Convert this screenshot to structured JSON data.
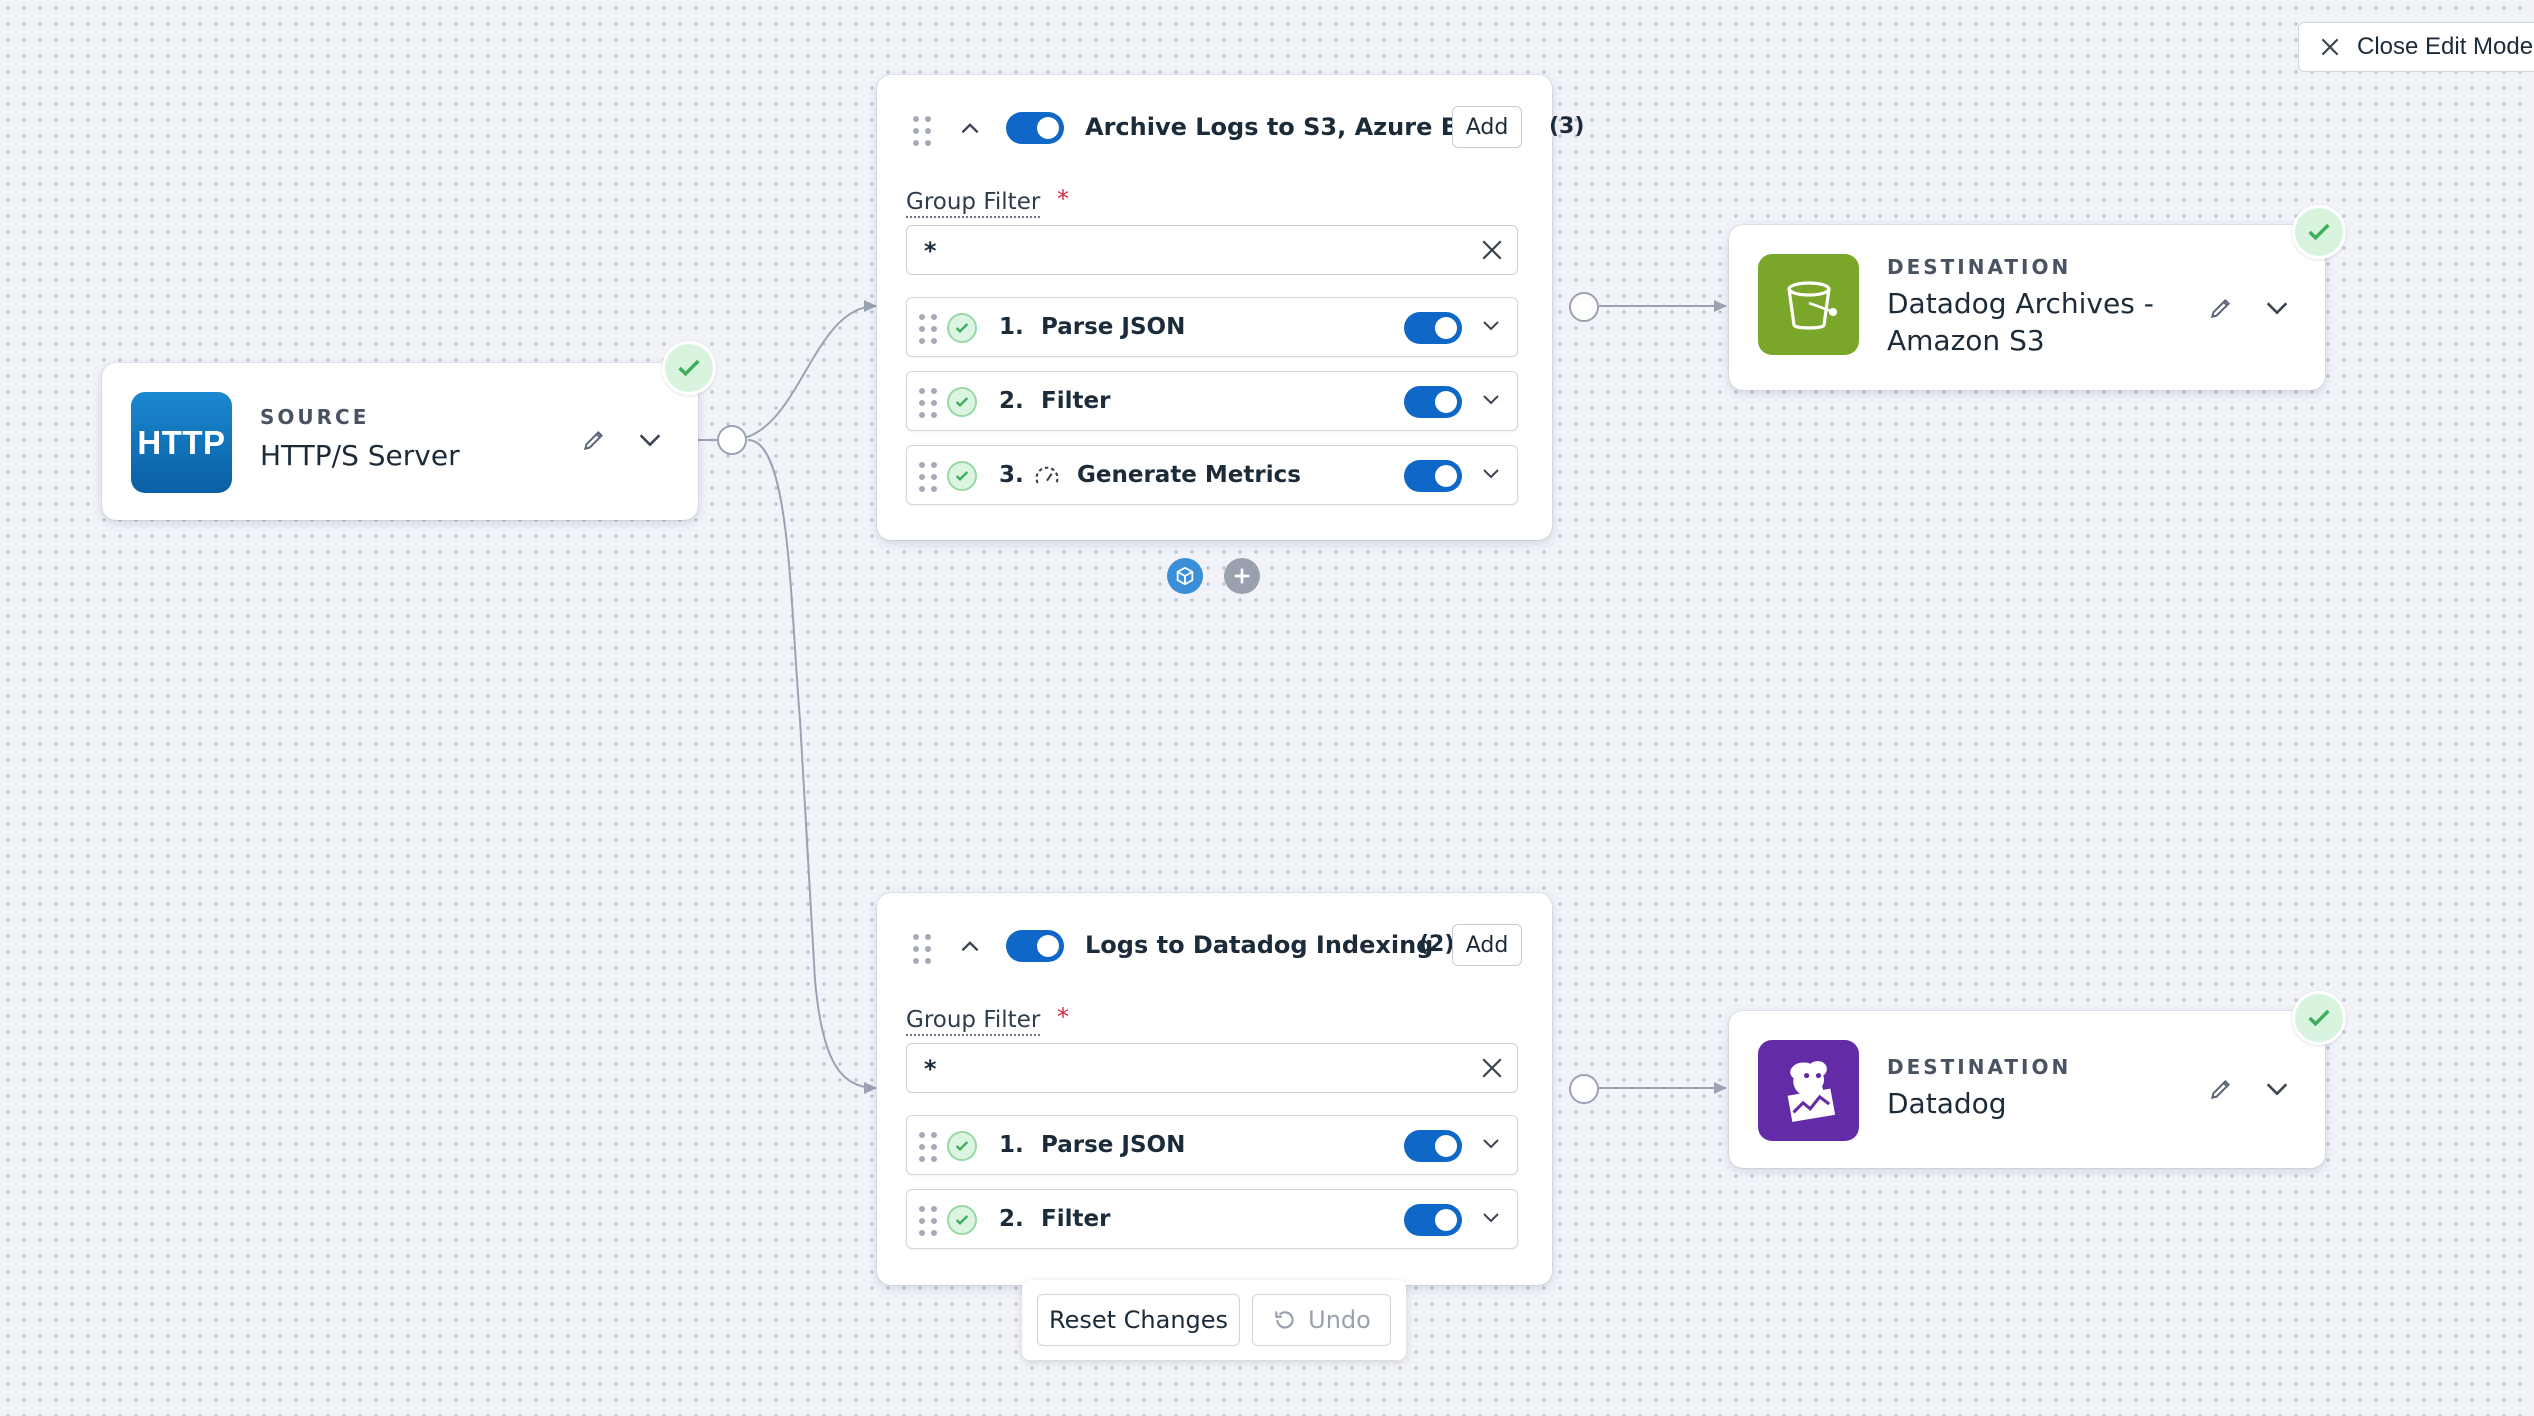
{
  "toolbar": {
    "close_edit_label": "Close Edit Mode"
  },
  "source": {
    "kind": "SOURCE",
    "name": "HTTP/S Server",
    "logo_text": "HTTP",
    "logo_color": "#0a6fb5",
    "status": "ok"
  },
  "groups": [
    {
      "title": "Archive Logs to S3, Azure Blob o",
      "count": "(3)",
      "add_label": "Add",
      "enabled": true,
      "filter_label": "Group Filter",
      "required_mark": "*",
      "filter_value": "*",
      "processors": [
        {
          "num": "1.",
          "name": "Parse JSON",
          "enabled": true,
          "status": "ok"
        },
        {
          "num": "2.",
          "name": "Filter",
          "enabled": true,
          "status": "ok"
        },
        {
          "num": "3.",
          "name": "Generate Metrics",
          "enabled": true,
          "status": "ok",
          "icon": "gauge-icon"
        }
      ]
    },
    {
      "title": "Logs to Datadog Indexing",
      "count": "(2)",
      "add_label": "Add",
      "enabled": true,
      "filter_label": "Group Filter",
      "required_mark": "*",
      "filter_value": "*",
      "processors": [
        {
          "num": "1.",
          "name": "Parse JSON",
          "enabled": true,
          "status": "ok"
        },
        {
          "num": "2.",
          "name": "Filter",
          "enabled": true,
          "status": "ok"
        }
      ]
    }
  ],
  "destinations": [
    {
      "kind": "DESTINATION",
      "name_line1": "Datadog Archives -",
      "name_line2": "Amazon S3",
      "logo_color": "#7aa72a",
      "icon": "bucket-icon",
      "status": "ok"
    },
    {
      "kind": "DESTINATION",
      "name_line1": "Datadog",
      "name_line2": "",
      "logo_color": "#632ca6",
      "icon": "datadog-dog-icon",
      "status": "ok"
    }
  ],
  "actions": {
    "reset_label": "Reset Changes",
    "undo_label": "Undo"
  },
  "colors": {
    "accent": "#0f67c7",
    "ok_green": "#3cae5c",
    "background": "#f1f3f9"
  }
}
